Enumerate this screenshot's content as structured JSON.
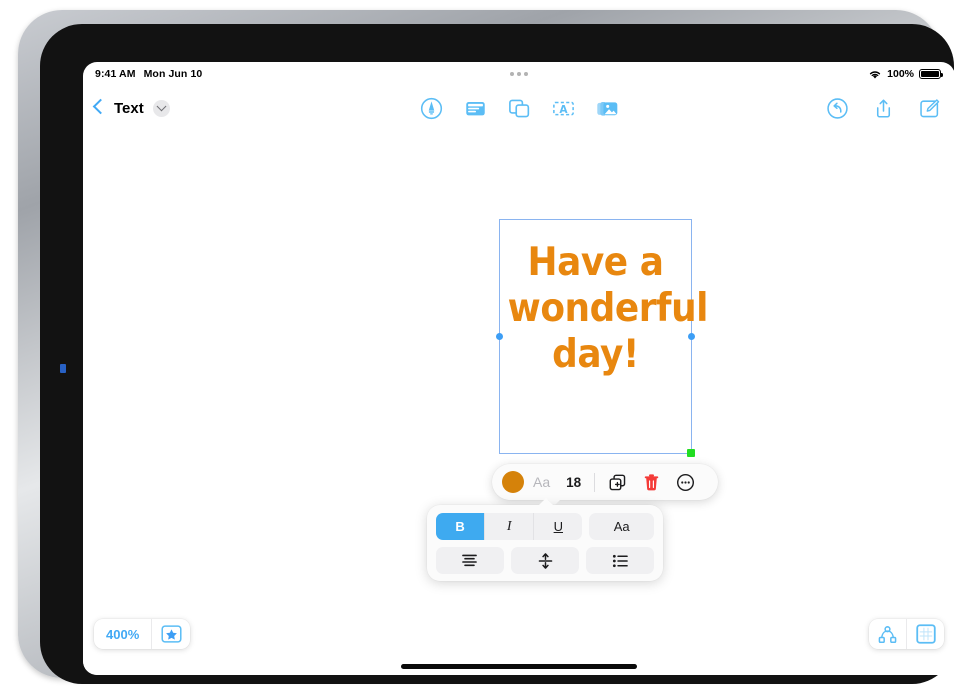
{
  "status_bar": {
    "time": "9:41 AM",
    "date": "Mon Jun 10",
    "wifi_icon": "wifi-icon",
    "battery_percent": "100%",
    "battery_icon": "battery-full-icon",
    "multitasking_icon": "multitasking-dots-icon"
  },
  "navbar": {
    "back_icon": "chevron-left-icon",
    "document_title": "Text",
    "title_menu_icon": "chevron-down-icon",
    "center_tools": [
      {
        "name": "draw-tool",
        "icon": "pen-in-circle-icon"
      },
      {
        "name": "note-tool",
        "icon": "note-card-icon"
      },
      {
        "name": "shape-tool",
        "icon": "shapes-icon"
      },
      {
        "name": "text-tool",
        "icon": "text-box-icon"
      },
      {
        "name": "media-tool",
        "icon": "photos-icon"
      }
    ],
    "right_tools": [
      {
        "name": "undo-button",
        "icon": "undo-arrow-icon"
      },
      {
        "name": "share-button",
        "icon": "share-icon"
      },
      {
        "name": "compose-button",
        "icon": "compose-pencil-icon"
      }
    ]
  },
  "canvas": {
    "selected_textbox": {
      "lines": [
        "Have a",
        "wonderful",
        "day!"
      ],
      "text_color": "#e8870f",
      "selection_border_color": "#8ab4f0",
      "handle_color": "#3d9ef5",
      "resize_handle_color": "#22dd22"
    }
  },
  "format_pill": {
    "color_swatch": "#d5820a",
    "font_label": "Aa",
    "font_size": "18",
    "duplicate_icon": "duplicate-icon",
    "delete_icon": "trash-icon",
    "more_icon": "more-ellipsis-circle-icon"
  },
  "format_panel": {
    "bold_label": "B",
    "bold_active": true,
    "italic_label": "I",
    "underline_label": "U",
    "font_style_label": "Aa",
    "align_icon": "align-center-icon",
    "line_spacing_icon": "line-spacing-icon",
    "list_icon": "bulleted-list-icon",
    "active_color": "#3eaaf0"
  },
  "bottom_bar": {
    "zoom_level": "400%",
    "favorite_icon": "star-in-square-icon",
    "nodes_icon": "connected-nodes-icon",
    "canvas_icon": "canvas-grid-icon",
    "accent_color": "#41a9f5"
  }
}
